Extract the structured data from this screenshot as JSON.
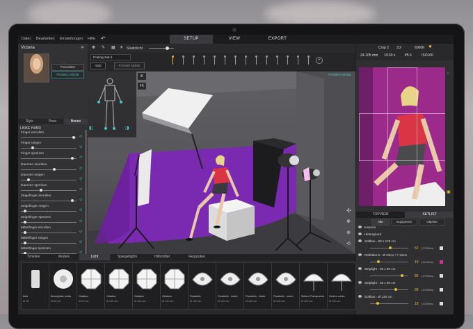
{
  "menubar": {
    "items": [
      "Datei",
      "Bearbeiten",
      "Einstellungen",
      "Hilfe"
    ],
    "undo_icon": "undo-icon",
    "tabs": [
      {
        "label": "SETUP",
        "active": true
      },
      {
        "label": "VIEW",
        "active": false
      },
      {
        "label": "EXPORT",
        "active": false
      }
    ]
  },
  "left_panel": {
    "title": "Victoria",
    "pose_slider_label": "PoseSlider",
    "posing_mode_label": "POSING MODE",
    "tabs": [
      {
        "label": "Style",
        "active": false
      },
      {
        "label": "Pose",
        "active": false
      },
      {
        "label": "Bones",
        "active": true
      }
    ],
    "section_title": "LINKE HAND",
    "sliders": [
      {
        "label": "Finger einrollen",
        "level": 0.97
      },
      {
        "label": "Finger neigen",
        "level": 0.2
      },
      {
        "label": "Finger spreizen",
        "level": 0.95
      },
      {
        "label": "Daumen einrollen",
        "level": 0.6
      },
      {
        "label": "Daumen neigen",
        "level": 0.12
      },
      {
        "label": "Daumen spreizen",
        "level": 0.35
      },
      {
        "label": "Zeigefinger einrollen",
        "level": 0.95
      },
      {
        "label": "Zeigefinger neigen",
        "level": 0.05
      },
      {
        "label": "Zeigefinger spreizen",
        "level": 0.05
      },
      {
        "label": "Mittelfinger einrollen",
        "level": 0.05
      },
      {
        "label": "Mittelfinger neigen",
        "level": 0.05
      },
      {
        "label": "Mittelfinger spreizen",
        "level": 0.05
      },
      {
        "label": "Ringfinger einrollen",
        "level": 0.05
      },
      {
        "label": "Ringfinger neigen",
        "level": 0.05
      },
      {
        "label": "Ringfinger spreizen",
        "level": 0.05
      }
    ]
  },
  "toolbar": {
    "studiolicht_label": "Studiolicht",
    "pose_set_label": "Posing-Set-1",
    "add_label": "ADD",
    "posing_mode_label": "POSING MODE"
  },
  "viewport": {
    "ik_label": "IK",
    "fk_label": "FK",
    "posing_mode_badge": "POSING MODE",
    "colors": {
      "backdrop": "#7a2ab0",
      "wall": "#5e5e62"
    }
  },
  "right_panel": {
    "camera": {
      "crop": "Crop 2",
      "ratio": "3:2",
      "kelvin": "6000K",
      "focal": "24-105 mm",
      "shutter": "1/160 s",
      "aperture": "f/5.6",
      "iso": "ISO100"
    },
    "tabs": [
      {
        "label": "TOPVIEW",
        "active": false
      },
      {
        "label": "SETLIST",
        "active": true
      }
    ],
    "subtabs": [
      {
        "label": "Alle",
        "active": true
      },
      {
        "label": "Equipment",
        "active": false
      },
      {
        "label": "Objekte",
        "active": false
      }
    ],
    "setlist": [
      {
        "name": "Kamera"
      },
      {
        "name": "Hintergrund"
      },
      {
        "name": "Softbox - 90 x 120 cm",
        "value": "52",
        "percent": "(2750Ws)",
        "level": 0.52,
        "swatch": "#dddddd"
      },
      {
        "name": "Reflektor 5 - Ø 23cm / 7 13cm",
        "value": "19",
        "percent": "(1100Ws)",
        "level": 0.19,
        "swatch": "#d0369a"
      },
      {
        "name": "Striplight - 25 x 90 cm",
        "value": "85",
        "percent": "(1750Ws)",
        "level": 0.85,
        "swatch": "#dddddd"
      },
      {
        "name": "Striplight - 25 x 90 cm",
        "value": "68",
        "percent": "(3750Ws)",
        "level": 0.68,
        "swatch": "#dddddd"
      },
      {
        "name": "Softbox - Ø 120 cm",
        "value": "18",
        "percent": "(1150Ws)",
        "level": 0.18,
        "swatch": "#dddddd"
      }
    ]
  },
  "bottom_panel": {
    "tabs": [
      {
        "label": "Timeline",
        "active": false
      },
      {
        "label": "Models",
        "active": false
      },
      {
        "label": "Licht",
        "active": true
      },
      {
        "label": "Spiegellights",
        "active": false
      },
      {
        "label": "Hilfsmittel",
        "active": false
      },
      {
        "label": "Requisiten",
        "active": false
      }
    ],
    "items": [
      {
        "name": "tube",
        "size": "Ø 18",
        "icon": "tube-icon"
      },
      {
        "name": "Beautydish weiss",
        "size": "Ø 60 cm",
        "icon": "beautydish-icon"
      },
      {
        "name": "Oktabox",
        "size": "Ø 90 cm",
        "icon": "octabox-icon"
      },
      {
        "name": "Oktabox",
        "size": "Ø 120 cm",
        "icon": "octabox-icon"
      },
      {
        "name": "Oktabox",
        "size": "Ø 120 cm",
        "icon": "octabox-icon"
      },
      {
        "name": "Oktabox",
        "size": "Ø 120 cm",
        "icon": "octabox-icon"
      },
      {
        "name": "Parabolic",
        "size": "Ø 120 cm",
        "icon": "parabolic-icon"
      },
      {
        "name": "Parabolic - innen",
        "size": "Ø 120 cm",
        "icon": "parabolic-icon"
      },
      {
        "name": "Parabolic - beste",
        "size": "Ø 120 cm",
        "icon": "parabolic-icon"
      },
      {
        "name": "Parabolic - innen",
        "size": "Ø 120 cm",
        "icon": "parabolic-icon"
      },
      {
        "name": "Schirm Transparent",
        "size": "Ø 120 cm",
        "icon": "umbrella-icon"
      },
      {
        "name": "Schirm weiss",
        "size": "Ø 120 cm",
        "icon": "umbrella-icon"
      }
    ]
  }
}
